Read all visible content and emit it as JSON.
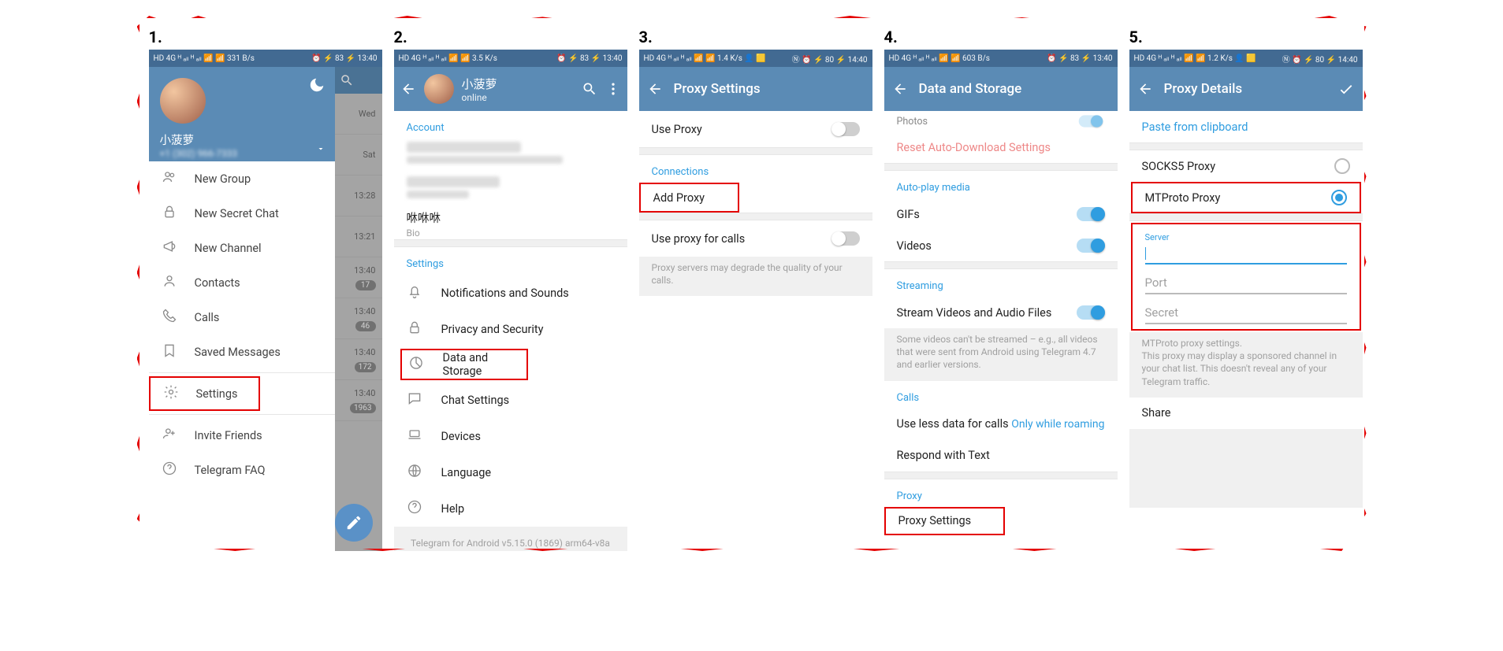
{
  "panels": {
    "p1": {
      "label": "1.",
      "status": {
        "left": "HD 4G ᴴ ₐₗₗ ᴴ ₐₗₗ 📶 📶 331 B/s",
        "right": "⏰ ⚡ 83 ⚡ 13:40"
      },
      "drawer": {
        "name": "小菠萝",
        "phone": "+1 (302) 966-7333",
        "items": [
          {
            "icon": "new-group",
            "label": "New Group"
          },
          {
            "icon": "lock",
            "label": "New Secret Chat"
          },
          {
            "icon": "megaphone",
            "label": "New Channel"
          },
          {
            "icon": "contact",
            "label": "Contacts"
          },
          {
            "icon": "phone",
            "label": "Calls"
          },
          {
            "icon": "bookmark",
            "label": "Saved Messages"
          },
          {
            "icon": "gear",
            "label": "Settings",
            "highlight": true
          },
          {
            "icon": "add-friend",
            "label": "Invite Friends"
          },
          {
            "icon": "help",
            "label": "Telegram FAQ"
          }
        ]
      },
      "chatlist_times": [
        "Wed",
        "Sat",
        "13:28",
        "13:21",
        "13:40",
        "13:40",
        "13:40",
        "13:40"
      ],
      "chatlist_badges": [
        "",
        "",
        "",
        "",
        "17",
        "46",
        "172",
        "1963"
      ]
    },
    "p2": {
      "label": "2.",
      "status": {
        "left": "HD 4G ᴴ ₐₗₗ ᴴ ₐₗₗ 📶 📶 3.5 K/s",
        "right": "⏰ ⚡ 83 ⚡ 13:40"
      },
      "profile": {
        "name": "小菠萝",
        "status": "online"
      },
      "sections": {
        "account_hdr": "Account",
        "bio_title": "咻咻咻",
        "bio_sub": "Bio",
        "settings_hdr": "Settings",
        "items": [
          {
            "icon": "bell",
            "label": "Notifications and Sounds"
          },
          {
            "icon": "lock",
            "label": "Privacy and Security"
          },
          {
            "icon": "pie",
            "label": "Data and Storage",
            "highlight": true
          },
          {
            "icon": "chat",
            "label": "Chat Settings"
          },
          {
            "icon": "laptop",
            "label": "Devices"
          },
          {
            "icon": "globe",
            "label": "Language"
          },
          {
            "icon": "help",
            "label": "Help"
          }
        ],
        "footer": "Telegram for Android v5.15.0 (1869) arm64-v8a"
      }
    },
    "p3": {
      "label": "3.",
      "status": {
        "left": "HD 4G ᴴ ₐₗₗ ᴴ ₐₗₗ 📶 📶 1.4 K/s 👤 🟨",
        "right": "Ⓝ ⏰ ⚡ 80 ⚡ 14:40"
      },
      "title": "Proxy Settings",
      "rows": {
        "use_proxy": "Use Proxy",
        "connections_hdr": "Connections",
        "add_proxy": "Add Proxy",
        "use_proxy_calls": "Use proxy for calls",
        "hint": "Proxy servers may degrade the quality of your calls."
      }
    },
    "p4": {
      "label": "4.",
      "status": {
        "left": "HD 4G ᴴ ₐₗₗ ᴴ ₐₗₗ 📶 📶 603 B/s",
        "right": "⏰ ⚡ 83 ⚡ 13:40"
      },
      "title": "Data and Storage",
      "rows": {
        "photos": "Photos",
        "reset": "Reset Auto-Download Settings",
        "autoplay_hdr": "Auto-play media",
        "gifs": "GIFs",
        "videos": "Videos",
        "streaming_hdr": "Streaming",
        "stream": "Stream Videos and Audio Files",
        "stream_hint": "Some videos can't be streamed – e.g., all videos that were sent from Android using Telegram 4.7 and earlier versions.",
        "calls_hdr": "Calls",
        "use_less": "Use less data for calls",
        "use_less_val": "Only while roaming",
        "respond": "Respond with Text",
        "proxy_hdr": "Proxy",
        "proxy_settings": "Proxy Settings"
      }
    },
    "p5": {
      "label": "5.",
      "status": {
        "left": "HD 4G ᴴ ₐₗₗ ᴴ ₐₗₗ 📶 📶 1.2 K/s 👤 🟨",
        "right": "Ⓝ ⏰ ⚡ 80 ⚡ 14:40"
      },
      "title": "Proxy Details",
      "rows": {
        "paste": "Paste from clipboard",
        "socks5": "SOCKS5 Proxy",
        "mtproto": "MTProto Proxy",
        "server_label": "Server",
        "port_label": "Port",
        "secret_label": "Secret",
        "hint_title": "MTProto proxy settings.",
        "hint_body": "This proxy may display a sponsored channel in your chat list. This doesn't reveal any of your Telegram traffic.",
        "share": "Share"
      }
    }
  }
}
